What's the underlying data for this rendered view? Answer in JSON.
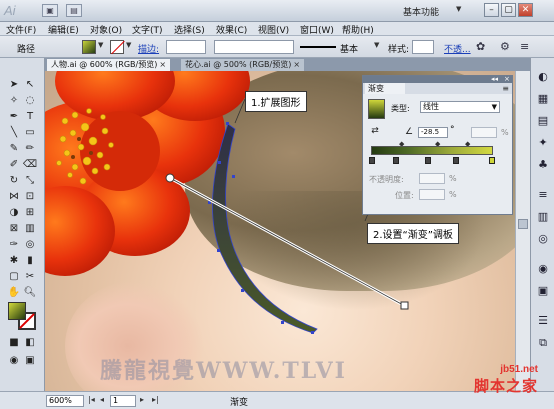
{
  "app": {
    "logo": "Ai",
    "workspace": "基本功能"
  },
  "menu": [
    "文件(F)",
    "编辑(E)",
    "对象(O)",
    "文字(T)",
    "选择(S)",
    "效果(C)",
    "视图(V)",
    "窗口(W)",
    "帮助(H)"
  ],
  "control": {
    "object_label": "路径",
    "stroke_link": "描边:",
    "stroke_style": "基本",
    "style_label": "样式:",
    "opacity_link": "不透..."
  },
  "tabs": [
    {
      "label": "人物.ai @ 600% (RGB/预览)",
      "close": "×"
    },
    {
      "label": "花心.ai @ 500% (RGB/预览)",
      "close": "×"
    }
  ],
  "gradient_panel": {
    "title": "渐变",
    "type_label": "类型:",
    "type_value": "线性",
    "angle_value": "-28.5",
    "angle_unit": "°",
    "opacity_label": "不透明度:",
    "location_label": "位置:",
    "percent": "%"
  },
  "callouts": {
    "step1": "1.扩展图形",
    "step2": "2.设置“渐变”调板"
  },
  "watermark": "騰龍視覺WWW.TLVI",
  "status": {
    "zoom": "600%",
    "page": "1",
    "label": "渐变"
  },
  "site": {
    "url": "jb51.net",
    "name": "脚本之家"
  },
  "colors": {
    "gradient_light": "#d3d941",
    "gradient_dark": "#243a12",
    "flower_red": "#e8320c",
    "flower_center": "#f5c518"
  }
}
